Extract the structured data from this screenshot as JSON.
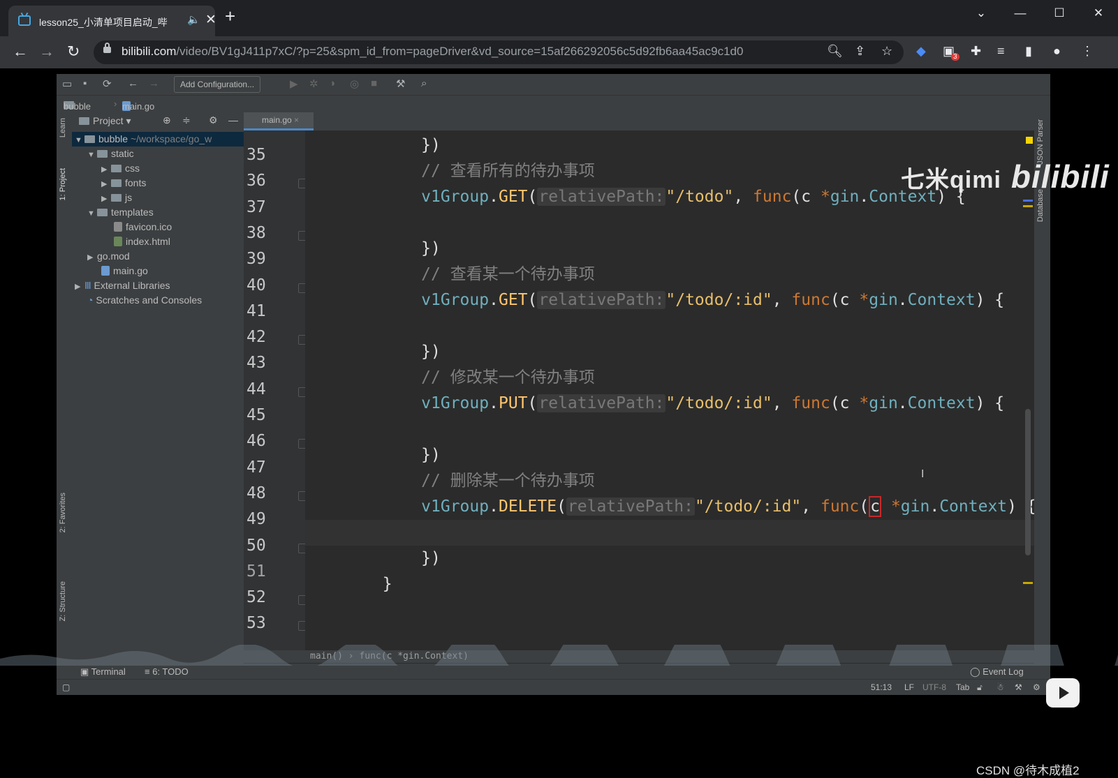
{
  "browser": {
    "tab_title": "lesson25_小清单项目启动_哔",
    "url_domain": "bilibili.com",
    "url_path": "/video/BV1gJ411p7xC/?p=25&spm_id_from=pageDriver&vd_source=15af266292056c5d92fb6aa45ac9c1d0",
    "extension_badge": "3"
  },
  "ide": {
    "add_configuration": "Add Configuration...",
    "breadcrumb": [
      "bubble",
      "main.go"
    ],
    "left_tools": [
      "1: Project",
      "Learn",
      "2: Favorites",
      "Z: Structure"
    ],
    "right_tools": [
      "Database",
      "JSON Parser"
    ],
    "project_header": "Project",
    "tree": [
      {
        "label": "bubble",
        "extra": "~/workspace/go_w"
      },
      {
        "label": "static"
      },
      {
        "label": "css"
      },
      {
        "label": "fonts"
      },
      {
        "label": "js"
      },
      {
        "label": "templates"
      },
      {
        "label": "favicon.ico"
      },
      {
        "label": "index.html"
      },
      {
        "label": "go.mod"
      },
      {
        "label": "main.go"
      },
      {
        "label": "External Libraries"
      },
      {
        "label": "Scratches and Consoles"
      }
    ],
    "editor_tab": "main.go",
    "line_numbers": [
      "35",
      "36",
      "37",
      "38",
      "39",
      "40",
      "41",
      "42",
      "43",
      "44",
      "45",
      "46",
      "47",
      "48",
      "49",
      "50",
      "51",
      "52",
      "53"
    ],
    "code": {
      "close": "})",
      "comment_37": "// 查看所有的待办事项",
      "comment_41": "// 查看某一个待办事项",
      "comment_45": "// 修改某一个待办事项",
      "comment_49": "// 删除某一个待办事项",
      "group": "v1Group",
      "get": "GET",
      "put": "PUT",
      "delete": "DELETE",
      "hint": "relativePath:",
      "path_all": "\"/todo\"",
      "path_id": "\"/todo/:id\"",
      "func": "func",
      "param": "c",
      "pkg": "gin",
      "type": "Context",
      "end_brace": "}"
    },
    "nav_crumb": "main() › func(c *gin.Context)",
    "bottom_tools": {
      "terminal": "Terminal",
      "todo": "6: TODO",
      "event_log": "Event Log"
    },
    "status": {
      "position": "51:13",
      "line_sep": "LF",
      "encoding": "UTF-8",
      "indent": "Tab"
    }
  },
  "overlay": {
    "watermark_name": "七米qimi",
    "watermark_brand": "bilibili",
    "csdn": "CSDN @待木成植2"
  }
}
